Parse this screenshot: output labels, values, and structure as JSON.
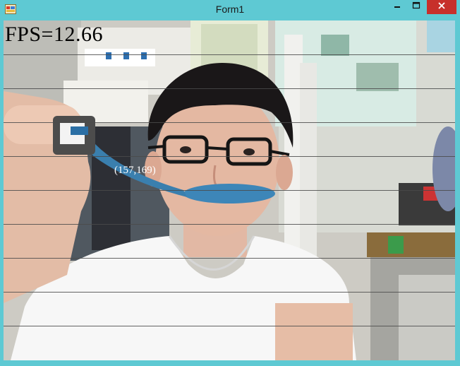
{
  "window": {
    "title": "Form1",
    "icons": {
      "app": "app-icon",
      "minimize": "minimize-icon",
      "maximize": "maximize-icon",
      "close": "close-icon"
    },
    "colors": {
      "frame": "#5ec9d3",
      "close_button": "#c7302b"
    }
  },
  "overlay": {
    "fps_text": "FPS=12.66",
    "coordinate_text": "(157,169)"
  }
}
